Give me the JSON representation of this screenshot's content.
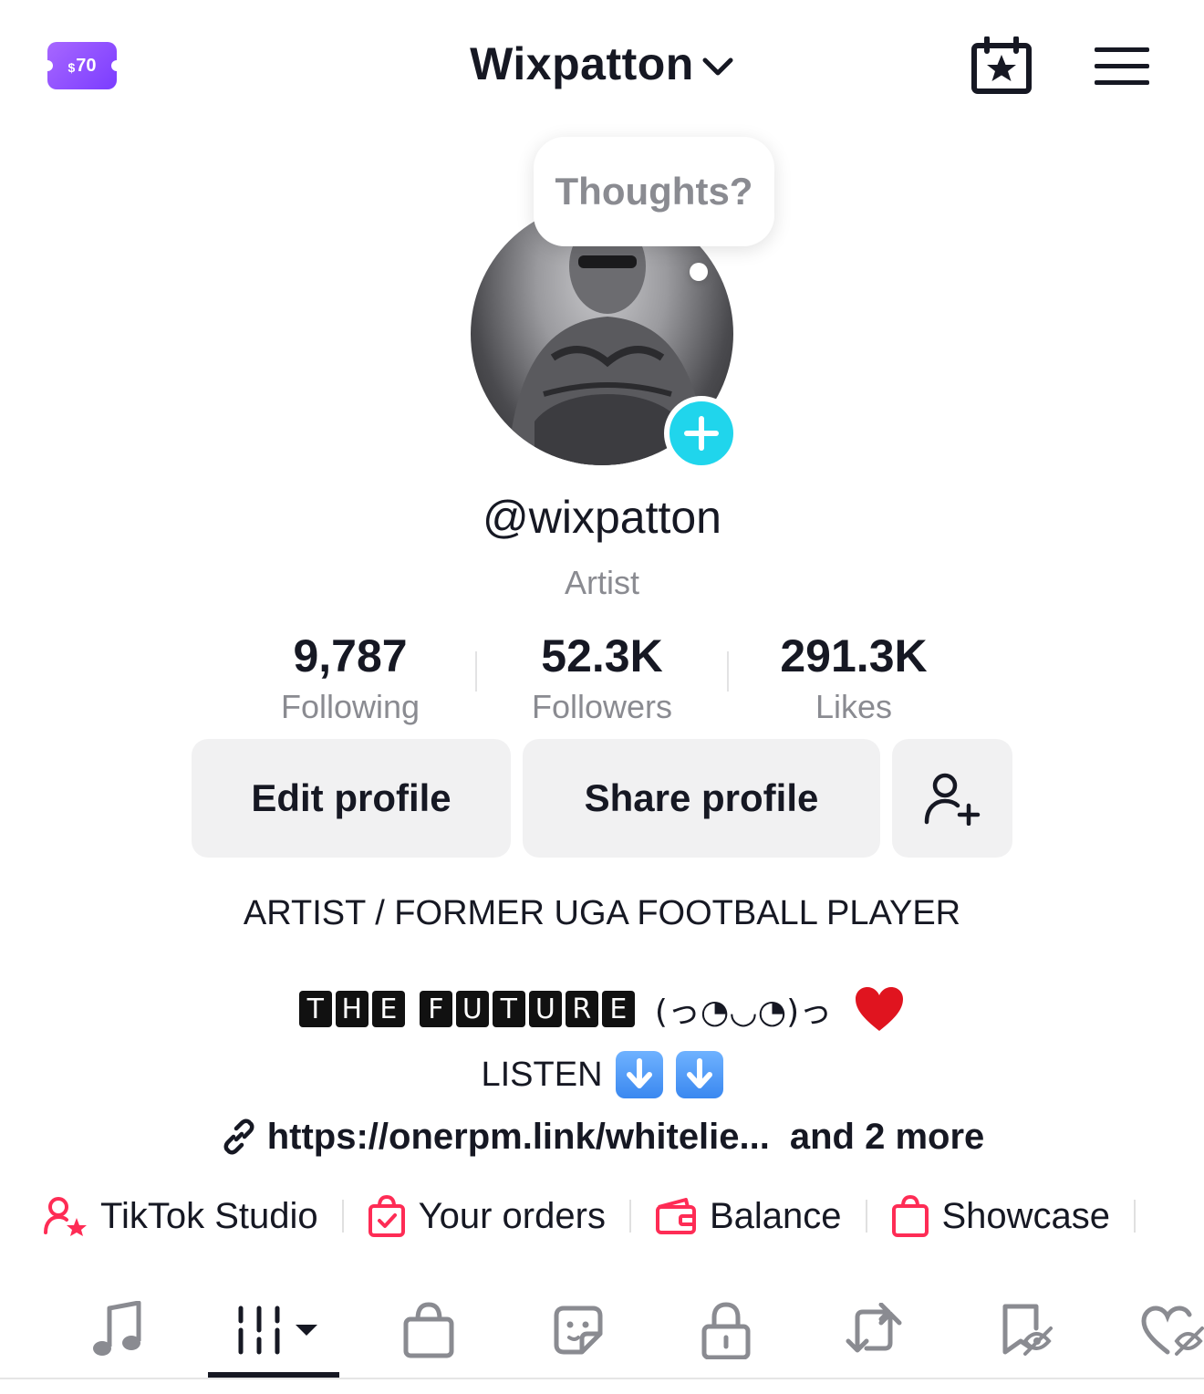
{
  "header": {
    "coupon_amount": "70",
    "coupon_currency": "$",
    "title": "Wixpatton",
    "accent_purple": "#8b4dff"
  },
  "bubble": {
    "text": "Thoughts?"
  },
  "profile": {
    "username": "@wixpatton",
    "category": "Artist",
    "badge_color": "#20d5ec"
  },
  "stats": [
    {
      "value": "9,787",
      "label": "Following"
    },
    {
      "value": "52.3K",
      "label": "Followers"
    },
    {
      "value": "291.3K",
      "label": "Likes"
    }
  ],
  "buttons": {
    "edit": "Edit profile",
    "share": "Share profile"
  },
  "bio": {
    "line1": "ARTIST / FORMER UGA FOOTBALL PLAYER",
    "word1": [
      "T",
      "H",
      "E"
    ],
    "word2": [
      "F",
      "U",
      "T",
      "U",
      "R",
      "E"
    ],
    "kaomoji": "(っ◔◡◔)っ",
    "line3": "LISTEN",
    "link": "https://onerpm.link/whitelie...",
    "more": "and 2 more"
  },
  "quick_actions": [
    {
      "label": "TikTok Studio",
      "icon": "studio-icon"
    },
    {
      "label": "Your orders",
      "icon": "orders-icon"
    },
    {
      "label": "Balance",
      "icon": "wallet-icon"
    },
    {
      "label": "Showcase",
      "icon": "showcase-icon"
    }
  ],
  "colors": {
    "tiktok_red": "#fe2c55",
    "text": "#161823",
    "muted": "#8a8b91"
  },
  "tabs": [
    "music-icon",
    "posts-grid-icon",
    "shop-icon",
    "sticker-icon",
    "private-lock-icon",
    "repost-icon",
    "favorites-icon",
    "liked-icon"
  ]
}
